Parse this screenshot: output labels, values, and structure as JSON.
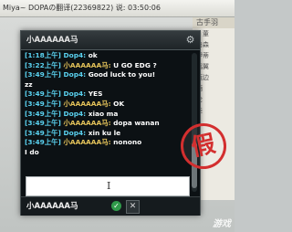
{
  "host_window": {
    "title": "Miya~  DOPAの翻译(22369822) 说: 03:50:06"
  },
  "background_list": {
    "header": "古手羽",
    "items": [
      "、董",
      "伯森",
      "伊蒂",
      "鸦翼",
      "西边",
      "酒",
      "伦",
      "娃"
    ]
  },
  "chat": {
    "title": "小AAAAAA马",
    "settings_icon": "gear-icon",
    "messages": [
      {
        "time": "[1:18上午]",
        "sender": "Dop4:",
        "sender_color": "#5ad2f0",
        "text": "ok"
      },
      {
        "time": "[3:22上午]",
        "sender": "小AAAAAA马:",
        "sender_color": "#e6c45a",
        "text": "U GO EDG ?"
      },
      {
        "time": "[3:49上午]",
        "sender": "Dop4:",
        "sender_color": "#5ad2f0",
        "text": "Good luck to you!"
      },
      {
        "time": "",
        "sender": "",
        "sender_color": "#ffffff",
        "text": "zz"
      },
      {
        "time": "[3:49上午]",
        "sender": "Dop4:",
        "sender_color": "#5ad2f0",
        "text": "YES"
      },
      {
        "time": "[3:49上午]",
        "sender": "小AAAAAA马:",
        "sender_color": "#e6c45a",
        "text": "OK"
      },
      {
        "time": "[3:49上午]",
        "sender": "Dop4:",
        "sender_color": "#5ad2f0",
        "text": "xiao ma"
      },
      {
        "time": "[3:49上午]",
        "sender": "小AAAAAA马:",
        "sender_color": "#e6c45a",
        "text": "dopa wanan"
      },
      {
        "time": "[3:49上午]",
        "sender": "Dop4:",
        "sender_color": "#5ad2f0",
        "text": "xin ku le"
      },
      {
        "time": "[3:49上午]",
        "sender": "小AAAAAA马:",
        "sender_color": "#e6c45a",
        "text": "nonono"
      },
      {
        "time": "",
        "sender": "",
        "sender_color": "#ffffff",
        "text": "I do"
      }
    ],
    "input_value": "",
    "footer_name": "小AAAAAA马",
    "send_icon": "check-circle-icon",
    "close_label": "✕"
  },
  "stamp_text": "假",
  "watermark_text": "游戏"
}
